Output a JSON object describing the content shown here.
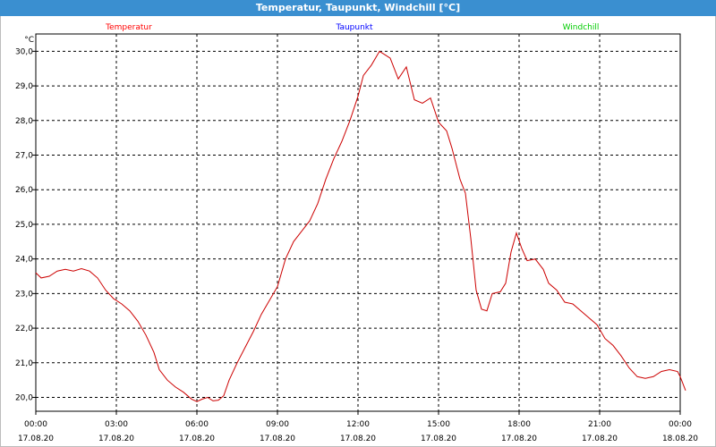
{
  "window": {
    "title": "Temperatur, Taupunkt, Windchill [°C]"
  },
  "chart_data": {
    "type": "line",
    "title": "Temperatur, Taupunkt, Windchill [°C]",
    "ylabel": "°C",
    "xlabel": "",
    "ylim": [
      19.6,
      30.5
    ],
    "y_ticks": [
      "20,0",
      "21,0",
      "22,0",
      "23,0",
      "24,0",
      "25,0",
      "26,0",
      "27,0",
      "28,0",
      "29,0",
      "30,0"
    ],
    "x_range_hours": [
      0,
      24
    ],
    "x_ticks": [
      {
        "time": "00:00",
        "date": "17.08.20"
      },
      {
        "time": "03:00",
        "date": "17.08.20"
      },
      {
        "time": "06:00",
        "date": "17.08.20"
      },
      {
        "time": "09:00",
        "date": "17.08.20"
      },
      {
        "time": "12:00",
        "date": "17.08.20"
      },
      {
        "time": "15:00",
        "date": "17.08.20"
      },
      {
        "time": "18:00",
        "date": "17.08.20"
      },
      {
        "time": "21:00",
        "date": "17.08.20"
      },
      {
        "time": "00:00",
        "date": "18.08.20"
      }
    ],
    "grid": true,
    "legend_position": "top",
    "series": [
      {
        "name": "Temperatur",
        "color": "#ff0000",
        "line_color": "#cc0000",
        "points": [
          [
            0.0,
            23.6
          ],
          [
            0.2,
            23.45
          ],
          [
            0.5,
            23.5
          ],
          [
            0.8,
            23.65
          ],
          [
            1.1,
            23.7
          ],
          [
            1.4,
            23.65
          ],
          [
            1.7,
            23.72
          ],
          [
            2.0,
            23.65
          ],
          [
            2.3,
            23.45
          ],
          [
            2.6,
            23.1
          ],
          [
            2.9,
            22.85
          ],
          [
            3.2,
            22.7
          ],
          [
            3.5,
            22.5
          ],
          [
            3.8,
            22.2
          ],
          [
            4.1,
            21.8
          ],
          [
            4.4,
            21.3
          ],
          [
            4.6,
            20.8
          ],
          [
            4.9,
            20.5
          ],
          [
            5.2,
            20.3
          ],
          [
            5.5,
            20.15
          ],
          [
            5.8,
            19.95
          ],
          [
            6.0,
            19.88
          ],
          [
            6.2,
            19.95
          ],
          [
            6.4,
            20.0
          ],
          [
            6.6,
            19.9
          ],
          [
            6.8,
            19.92
          ],
          [
            7.0,
            20.05
          ],
          [
            7.2,
            20.5
          ],
          [
            7.5,
            21.0
          ],
          [
            7.8,
            21.45
          ],
          [
            8.1,
            21.9
          ],
          [
            8.4,
            22.4
          ],
          [
            8.7,
            22.8
          ],
          [
            9.0,
            23.2
          ],
          [
            9.3,
            24.0
          ],
          [
            9.6,
            24.5
          ],
          [
            9.9,
            24.8
          ],
          [
            10.2,
            25.1
          ],
          [
            10.5,
            25.6
          ],
          [
            10.8,
            26.3
          ],
          [
            11.1,
            26.9
          ],
          [
            11.4,
            27.4
          ],
          [
            11.7,
            28.0
          ],
          [
            12.0,
            28.7
          ],
          [
            12.2,
            29.3
          ],
          [
            12.5,
            29.6
          ],
          [
            12.8,
            30.0
          ],
          [
            13.0,
            29.9
          ],
          [
            13.2,
            29.8
          ],
          [
            13.5,
            29.2
          ],
          [
            13.8,
            29.55
          ],
          [
            14.1,
            28.6
          ],
          [
            14.4,
            28.5
          ],
          [
            14.7,
            28.65
          ],
          [
            15.0,
            27.95
          ],
          [
            15.3,
            27.7
          ],
          [
            15.5,
            27.2
          ],
          [
            15.8,
            26.3
          ],
          [
            16.0,
            25.9
          ],
          [
            16.2,
            24.6
          ],
          [
            16.4,
            23.1
          ],
          [
            16.6,
            22.55
          ],
          [
            16.8,
            22.5
          ],
          [
            17.0,
            23.0
          ],
          [
            17.3,
            23.05
          ],
          [
            17.5,
            23.3
          ],
          [
            17.7,
            24.2
          ],
          [
            17.9,
            24.75
          ],
          [
            18.1,
            24.3
          ],
          [
            18.3,
            23.95
          ],
          [
            18.6,
            24.0
          ],
          [
            18.9,
            23.7
          ],
          [
            19.1,
            23.3
          ],
          [
            19.4,
            23.1
          ],
          [
            19.7,
            22.75
          ],
          [
            20.0,
            22.7
          ],
          [
            20.3,
            22.5
          ],
          [
            20.6,
            22.3
          ],
          [
            20.9,
            22.1
          ],
          [
            21.2,
            21.7
          ],
          [
            21.5,
            21.5
          ],
          [
            21.8,
            21.2
          ],
          [
            22.1,
            20.85
          ],
          [
            22.4,
            20.6
          ],
          [
            22.7,
            20.55
          ],
          [
            23.0,
            20.6
          ],
          [
            23.3,
            20.75
          ],
          [
            23.6,
            20.8
          ],
          [
            23.9,
            20.75
          ],
          [
            24.0,
            20.6
          ],
          [
            24.2,
            20.2
          ]
        ]
      },
      {
        "name": "Taupunkt",
        "color": "#0000ff",
        "points": []
      },
      {
        "name": "Windchill",
        "color": "#00cc00",
        "points": []
      }
    ]
  }
}
